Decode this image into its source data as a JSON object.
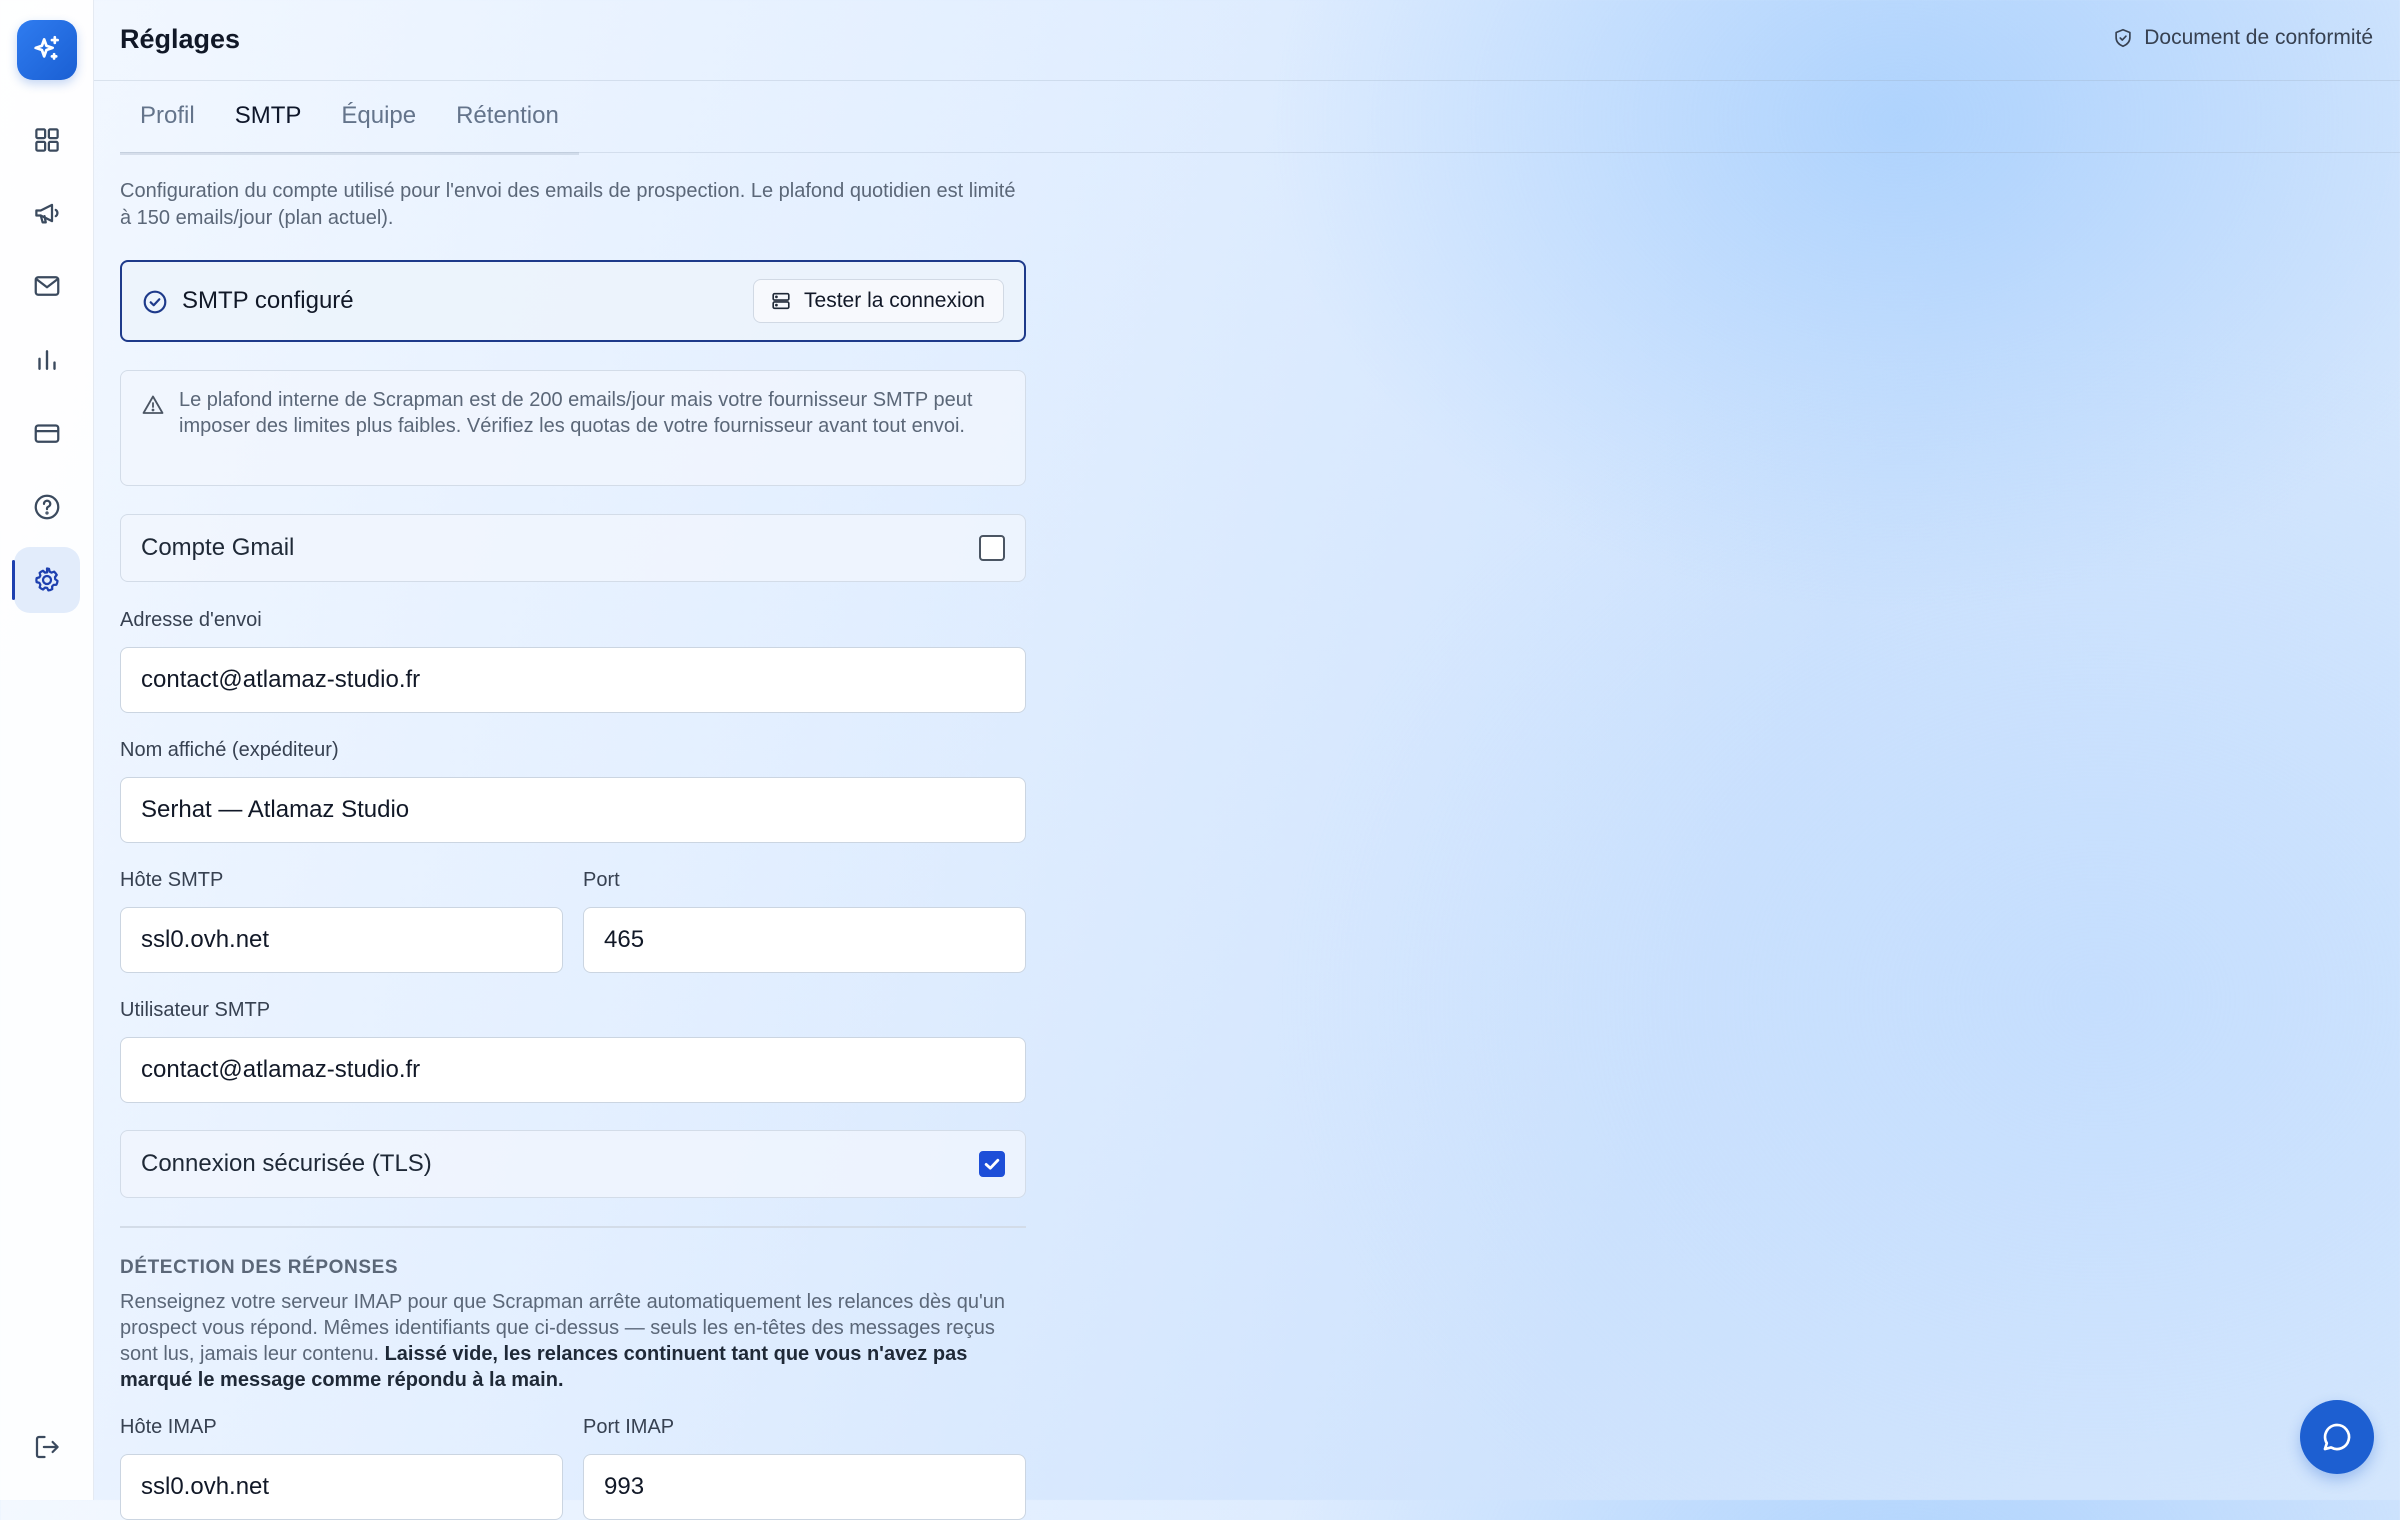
{
  "header": {
    "title": "Réglages",
    "compliance_link": "Document de conformité"
  },
  "sidebar": {
    "items": [
      {
        "icon": "grid-icon",
        "label": "dashboard"
      },
      {
        "icon": "megaphone-icon",
        "label": "campaigns"
      },
      {
        "icon": "mail-icon",
        "label": "emails"
      },
      {
        "icon": "bar-chart-icon",
        "label": "statistics"
      },
      {
        "icon": "credit-card-icon",
        "label": "billing"
      },
      {
        "icon": "help-circle-icon",
        "label": "help"
      },
      {
        "icon": "gear-icon",
        "label": "settings",
        "active": true
      }
    ],
    "logout_icon": "logout-icon"
  },
  "tabs": [
    {
      "label": "Profil",
      "active": false
    },
    {
      "label": "SMTP",
      "active": true
    },
    {
      "label": "Équipe",
      "active": false
    },
    {
      "label": "Rétention",
      "active": false
    }
  ],
  "smtp": {
    "intro": "Configuration du compte utilisé pour l'envoi des emails de prospection. Le plafond quotidien est limité à 150 emails/jour (plan actuel).",
    "status": "SMTP configuré",
    "test_button": "Tester la connexion",
    "warning": "Le plafond interne de Scrapman est de 200 emails/jour mais votre fournisseur SMTP peut imposer des limites plus faibles. Vérifiez les quotas de votre fournisseur avant tout envoi.",
    "gmail_toggle": {
      "label": "Compte Gmail",
      "checked": false
    },
    "sender_address": {
      "label": "Adresse d'envoi",
      "value": "contact@atlamaz-studio.fr"
    },
    "display_name": {
      "label": "Nom affiché (expéditeur)",
      "value": "Serhat — Atlamaz Studio"
    },
    "host": {
      "label": "Hôte SMTP",
      "value": "ssl0.ovh.net"
    },
    "port": {
      "label": "Port",
      "value": "465"
    },
    "user": {
      "label": "Utilisateur SMTP",
      "value": "contact@atlamaz-studio.fr"
    },
    "tls_toggle": {
      "label": "Connexion sécurisée (TLS)",
      "checked": true
    }
  },
  "replies": {
    "title": "DÉTECTION DES RÉPONSES",
    "description": "Renseignez votre serveur IMAP pour que Scrapman arrête automatiquement les relances dès qu'un prospect vous répond. Mêmes identifiants que ci-dessus — seuls les en-têtes des messages reçus sont lus, jamais leur contenu.",
    "description_bold": "Laissé vide, les relances continuent tant que vous n'avez pas marqué le message comme répondu à la main.",
    "imap_host": {
      "label": "Hôte IMAP",
      "value": "ssl0.ovh.net"
    },
    "imap_port": {
      "label": "Port IMAP",
      "value": "993"
    }
  },
  "chat_icon": "chat-bubble-icon",
  "colors": {
    "accent": "#1d5fd1",
    "nav_active_bg": "#e2ecfb",
    "status_border": "#1e3a8a"
  }
}
